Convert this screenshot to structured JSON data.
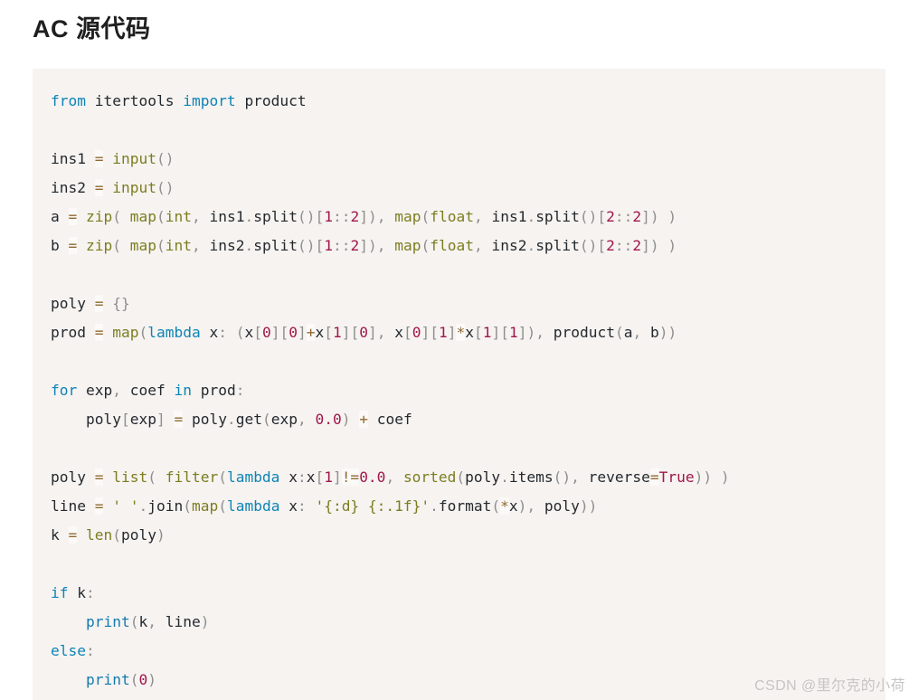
{
  "header": {
    "title": "AC 源代码"
  },
  "watermark": {
    "text": "CSDN @里尔克的小荷"
  },
  "code_block": {
    "language": "python",
    "background_color": "#f6f3f1",
    "full_text": "from itertools import product\n\nins1 = input()\nins2 = input()\na = zip( map(int, ins1.split()[1::2]), map(float, ins1.split()[2::2]) )\nb = zip( map(int, ins2.split()[1::2]), map(float, ins2.split()[2::2]) )\n\npoly = {}\nprod = map(lambda x: (x[0][0]+x[1][0], x[0][1]*x[1][1]), product(a, b))\n\nfor exp, coef in prod:\n    poly[exp] = poly.get(exp, 0.0) + coef\n\npoly = list( filter(lambda x:x[1]!=0.0, sorted(poly.items(), reverse=True)) )\nline = ' '.join(map(lambda x: '{:d} {:.1f}'.format(*x), poly))\nk = len(poly)\n\nif k:\n    print(k, line)\nelse:\n    print(0)",
    "lines": [
      "from itertools import product",
      "",
      "ins1 = input()",
      "ins2 = input()",
      "a = zip( map(int, ins1.split()[1::2]), map(float, ins1.split()[2::2]) )",
      "b = zip( map(int, ins2.split()[1::2]), map(float, ins2.split()[2::2]) )",
      "",
      "poly = {}",
      "prod = map(lambda x: (x[0][0]+x[1][0], x[0][1]*x[1][1]), product(a, b))",
      "",
      "for exp, coef in prod:",
      "    poly[exp] = poly.get(exp, 0.0) + coef",
      "",
      "poly = list( filter(lambda x:x[1]!=0.0, sorted(poly.items(), reverse=True)) )",
      "line = ' '.join(map(lambda x: '{:d} {:.1f}'.format(*x), poly))",
      "k = len(poly)",
      "",
      "if k:",
      "    print(k, line)",
      "else:",
      "    print(0)"
    ],
    "token_colors": {
      "keyword": "#0e84b5",
      "builtin": "#7d7d20",
      "number": "#a0174a",
      "boolean": "#a0174a",
      "operator": "#8f6a30",
      "punctuation": "#8f8f8f",
      "string": "#7d7d20",
      "print": "#1679ad",
      "identifier": "#24292e"
    }
  }
}
